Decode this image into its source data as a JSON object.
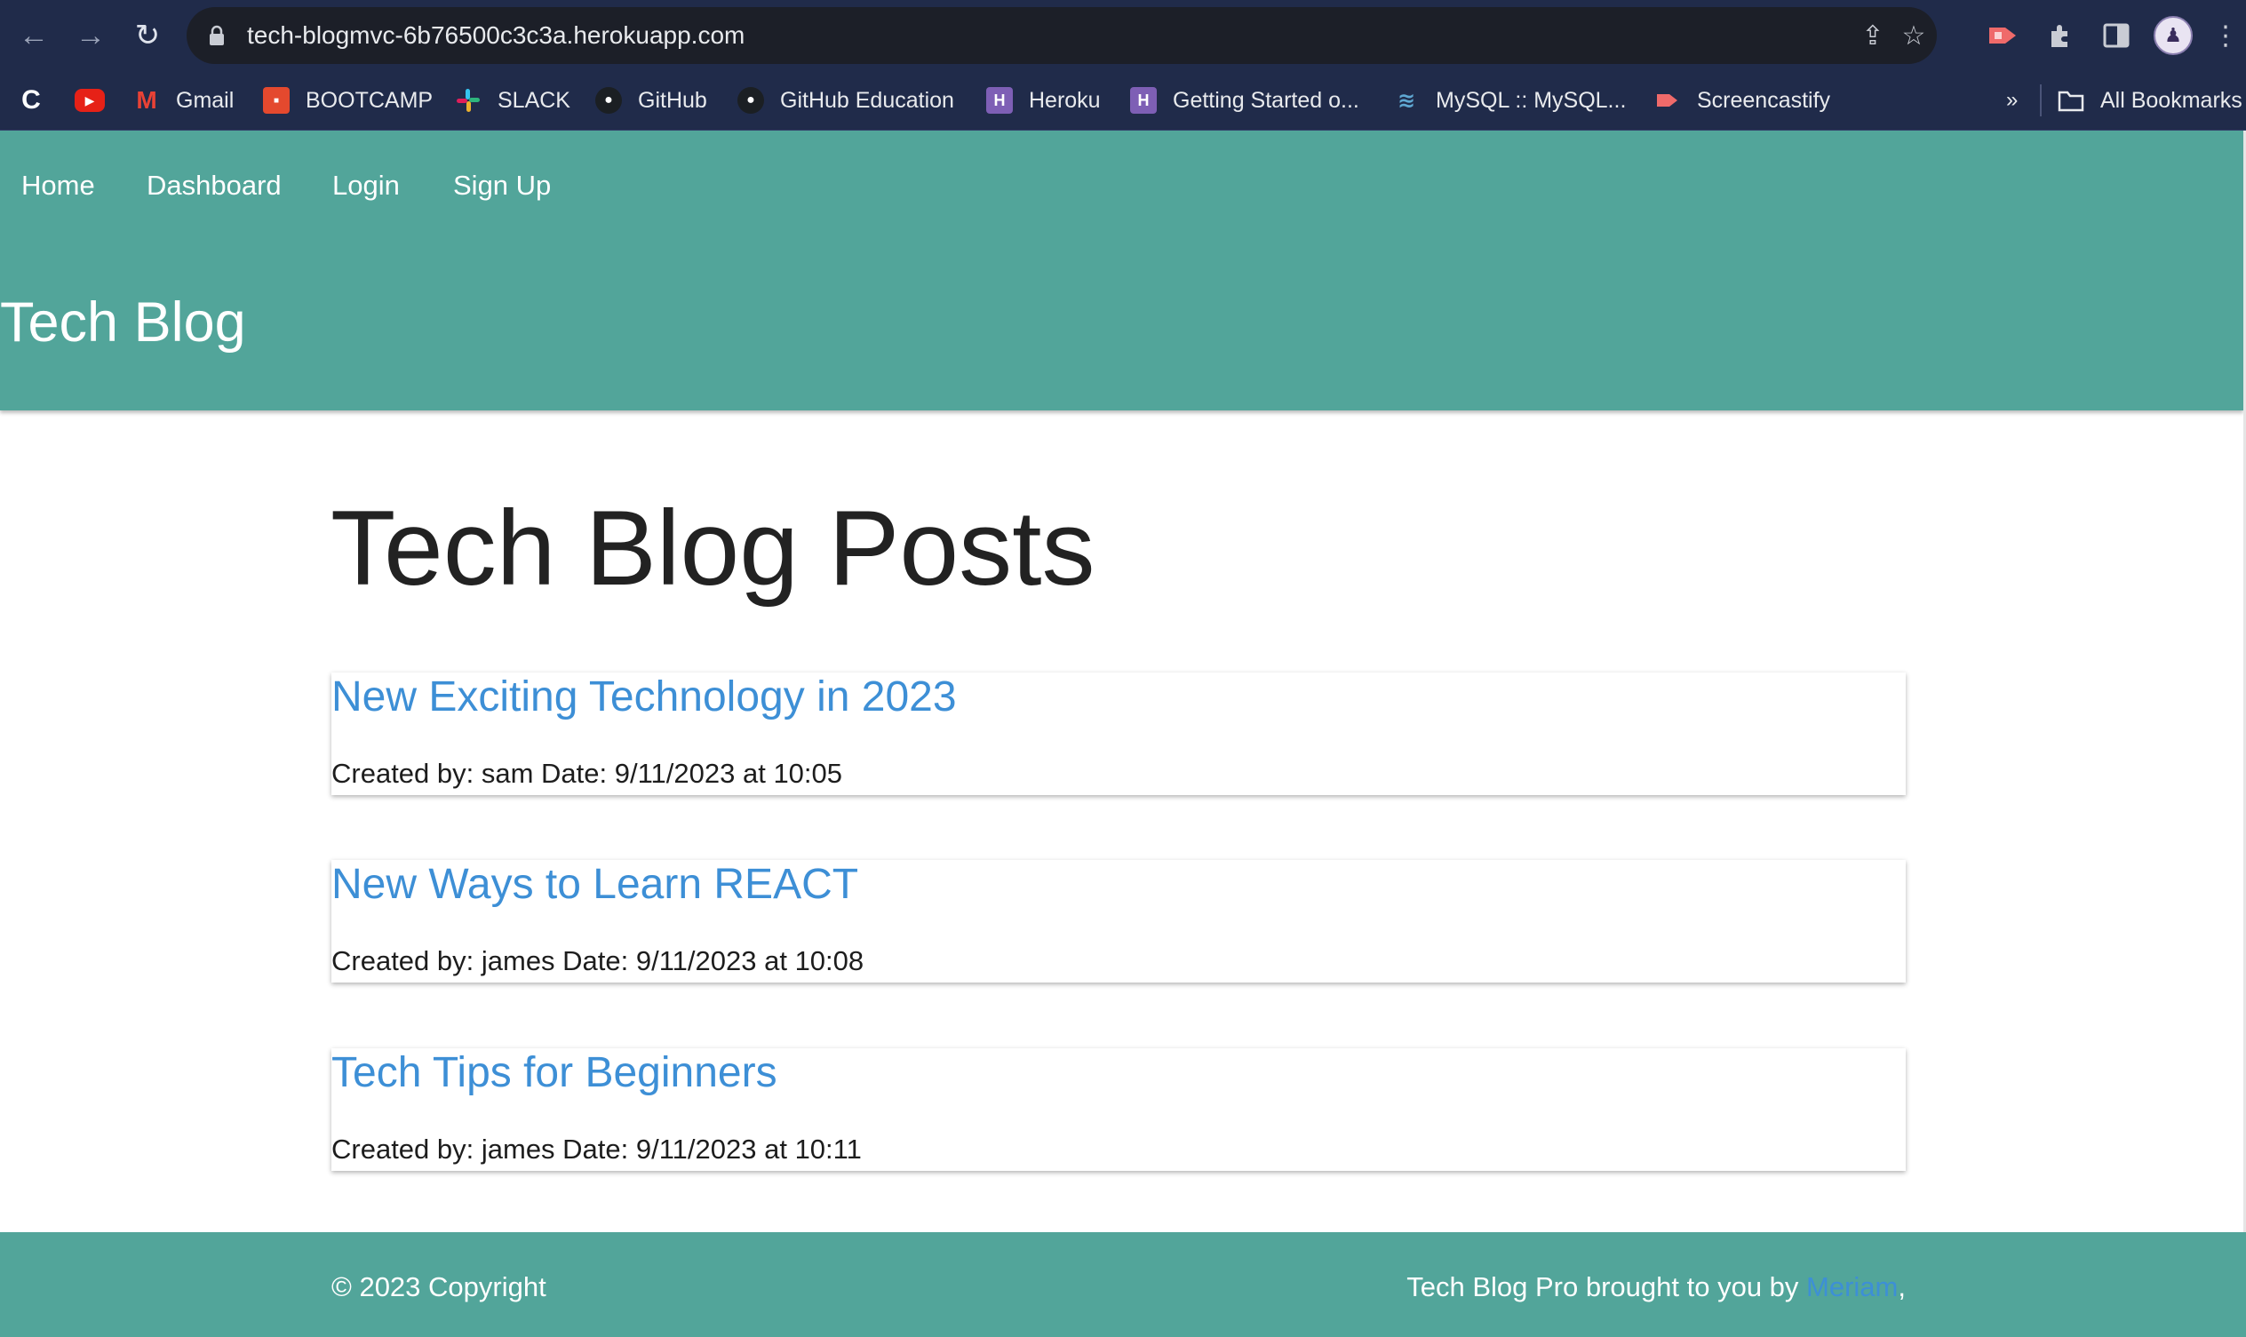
{
  "browser": {
    "url": "tech-blogmvc-6b76500c3c3a.herokuapp.com",
    "icons": [
      "back-arrow-icon",
      "forward-arrow-icon",
      "reload-icon",
      "lock-icon",
      "share-icon",
      "star-icon",
      "screencastify-icon",
      "extensions-icon",
      "side-panel-icon",
      "profile-avatar-icon",
      "more-menu-icon"
    ],
    "bookmarks": [
      {
        "label": "",
        "icon": "c-logo-icon"
      },
      {
        "label": "",
        "icon": "youtube-icon"
      },
      {
        "label": "Gmail",
        "icon": "gmail-icon"
      },
      {
        "label": "BOOTCAMP",
        "icon": "bootcamp-icon"
      },
      {
        "label": "SLACK",
        "icon": "slack-icon"
      },
      {
        "label": "GitHub",
        "icon": "github-icon"
      },
      {
        "label": "GitHub Education",
        "icon": "github-icon"
      },
      {
        "label": "Heroku",
        "icon": "heroku-icon"
      },
      {
        "label": "Getting Started o...",
        "icon": "heroku-icon"
      },
      {
        "label": "MySQL :: MySQL...",
        "icon": "mysql-icon"
      },
      {
        "label": "Screencastify",
        "icon": "screencastify-icon"
      }
    ],
    "overflow": "»",
    "all_bookmarks": "All Bookmarks"
  },
  "site": {
    "nav": [
      "Home",
      "Dashboard",
      "Login",
      "Sign Up"
    ],
    "title": "Tech Blog"
  },
  "main": {
    "heading": "Tech Blog Posts",
    "posts": [
      {
        "title": "New Exciting Technology in 2023",
        "meta": "Created by: sam Date: 9/11/2023 at 10:05"
      },
      {
        "title": "New Ways to Learn REACT",
        "meta": "Created by: james Date: 9/11/2023 at 10:08"
      },
      {
        "title": "Tech Tips for Beginners",
        "meta": "Created by: james Date: 9/11/2023 at 10:11"
      }
    ]
  },
  "footer": {
    "copyright": "© 2023 Copyright",
    "credit_prefix": "Tech Blog Pro brought to you by ",
    "credit_author": "Meriam",
    "credit_suffix": ","
  },
  "colors": {
    "header_bg": "#52a59a",
    "link": "#3d8fd6",
    "browser_chrome": "#202b4a"
  }
}
